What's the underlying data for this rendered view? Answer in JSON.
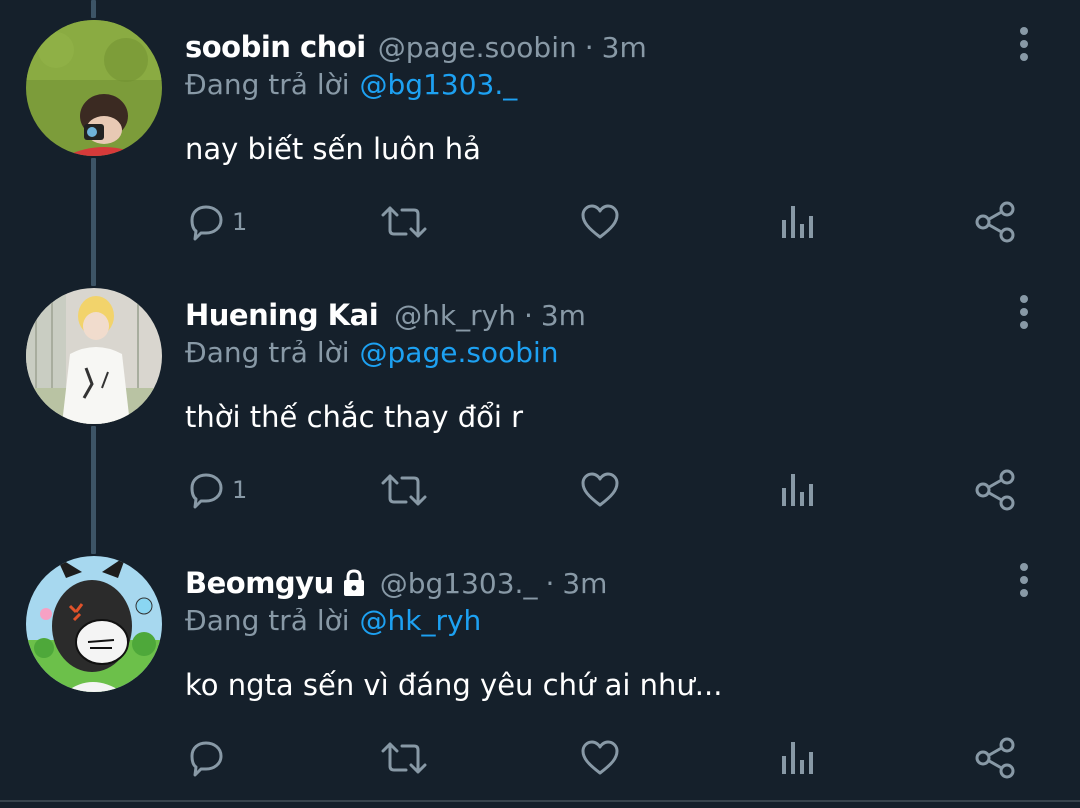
{
  "colors": {
    "background": "#15202b",
    "name": "#ffffff",
    "secondary": "#8899a6",
    "mention": "#1da1f2",
    "thread_line": "#3d5466"
  },
  "tweets": [
    {
      "display_name": "soobin choi",
      "handle": "@page.soobin",
      "dot": "·",
      "time": "3m",
      "reply_prefix": "Đang trả lời",
      "reply_to": "@bg1303._",
      "text": "nay biết sến luôn hả",
      "reply_count": "1",
      "locked": false,
      "avatar_icon": "avatar-photo-grass"
    },
    {
      "display_name": "Huening Kai",
      "handle": "@hk_ryh",
      "dot": "·",
      "time": "3m",
      "reply_prefix": "Đang trả lời",
      "reply_to": "@page.soobin",
      "text": "thời thế chắc thay đổi r",
      "reply_count": "1",
      "locked": false,
      "avatar_icon": "avatar-photo-person"
    },
    {
      "display_name": "Beomgyu",
      "handle": "@bg1303._",
      "dot": "·",
      "time": "3m",
      "reply_prefix": "Đang trả lời",
      "reply_to": "@hk_ryh",
      "text": "ko ngta sến vì đáng yêu chứ ai như...",
      "reply_count": "",
      "locked": true,
      "avatar_icon": "avatar-cartoon"
    }
  ],
  "icons": {
    "more": "more-vertical-icon",
    "reply": "reply-bubble-icon",
    "retweet": "retweet-icon",
    "like": "heart-icon",
    "stats": "analytics-bars-icon",
    "share": "share-icon",
    "lock": "lock-icon"
  }
}
